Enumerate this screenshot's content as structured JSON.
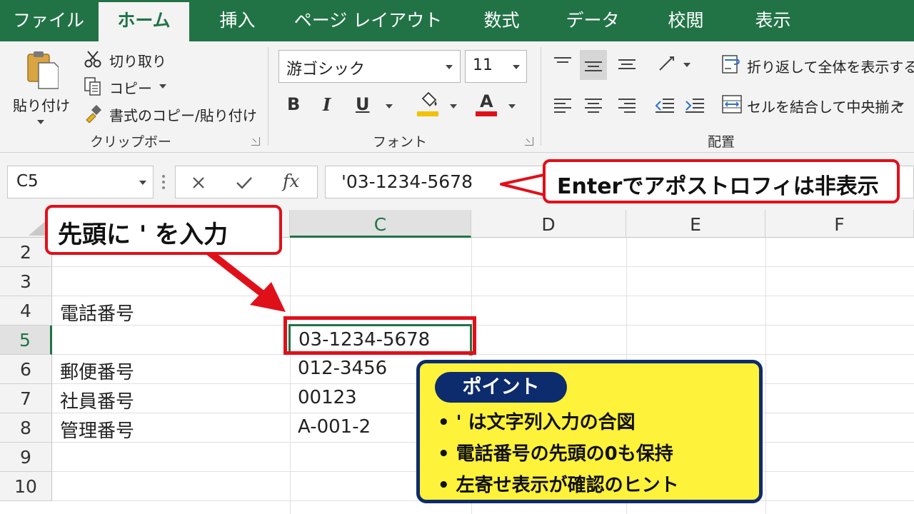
{
  "menu": {
    "tabs": [
      "ファイル",
      "ホーム",
      "挿入",
      "ページ レイアウト",
      "数式",
      "データ",
      "校閲",
      "表示"
    ],
    "active": "ホーム"
  },
  "ribbon": {
    "clipboard": {
      "paste": "貼り付け",
      "cut": "切り取り",
      "copy": "コピー",
      "format_painter": "書式のコピー/貼り付け",
      "label": "クリップボード"
    },
    "font": {
      "font_name": "游ゴシック",
      "font_size": "11",
      "bold": "B",
      "italic": "I",
      "underline": "U",
      "font_color_letter": "A",
      "fill_color": "#f2c200",
      "font_color": "#e0101a",
      "label": "フォント"
    },
    "alignment": {
      "wrap_text": "折り返して全体を表示する",
      "merge_center": "セルを結合して中央揃え",
      "label": "配置"
    }
  },
  "formula_bar": {
    "name_box": "C5",
    "fx": "fx",
    "value": "'03-1234-5678"
  },
  "grid": {
    "columns": [
      "C",
      "D",
      "E",
      "F"
    ],
    "selected_column": "C",
    "rows": [
      "2",
      "3",
      "4",
      "5",
      "6",
      "7",
      "8",
      "9",
      "10"
    ],
    "selected_row": "5",
    "cells": {
      "b4": "電話番号",
      "c5": "03-1234-5678",
      "b6": "郵便番号",
      "c6": "012-3456",
      "b7": "社員番号",
      "c7": "00123",
      "b8": "管理番号",
      "c8": "A-001-2"
    }
  },
  "annotations": {
    "formula_callout": "Enterでアポストロフィは非表示",
    "input_callout": "先頭に ' を入力",
    "point": {
      "title": "ポイント",
      "items": [
        "' は文字列入力の合図",
        "電話番号の先頭の0も保持",
        "左寄せ表示が確認のヒント"
      ]
    }
  },
  "colors": {
    "excel_green": "#217346",
    "annotation_red": "#e0101a",
    "point_yellow": "#fff23b",
    "point_navy": "#0d2c6e"
  }
}
